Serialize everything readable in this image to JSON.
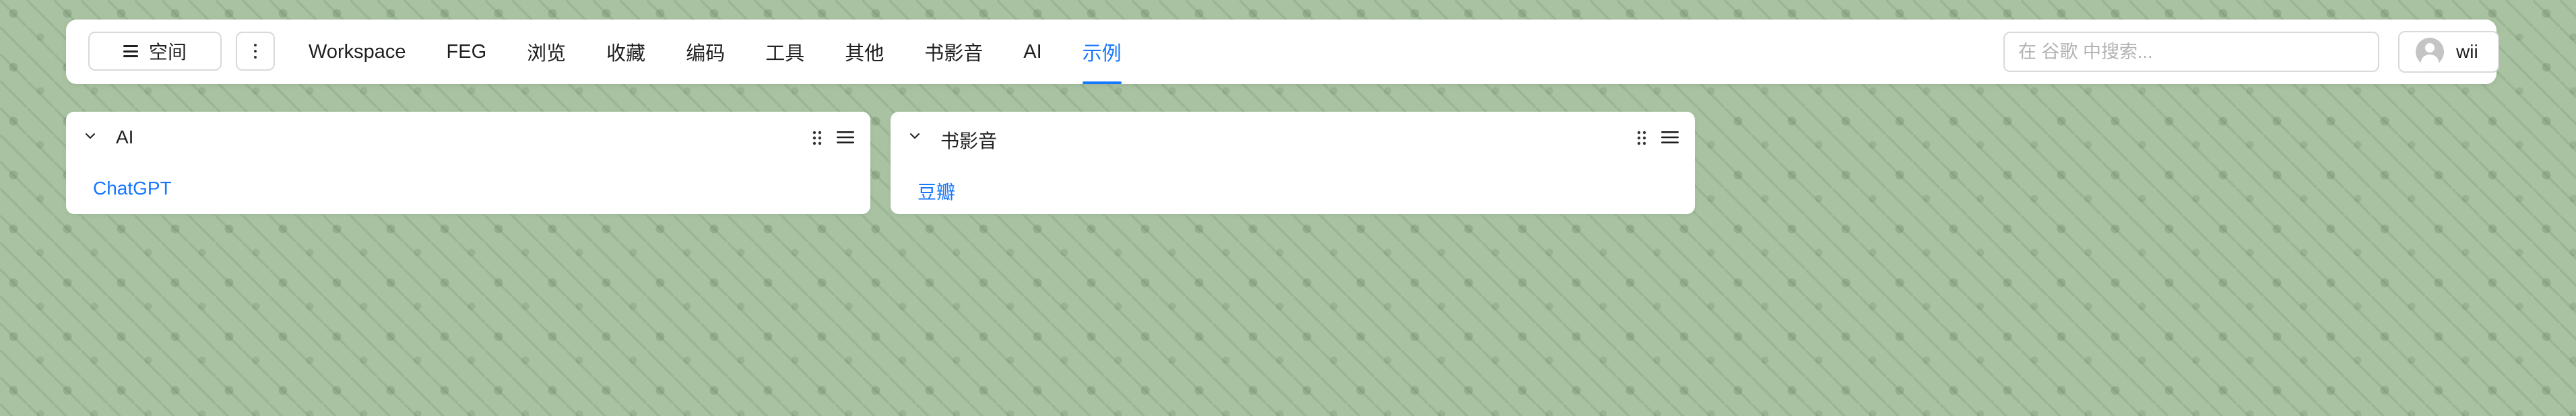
{
  "header": {
    "space_label": "空间",
    "tabs": [
      {
        "label": "Workspace"
      },
      {
        "label": "FEG"
      },
      {
        "label": "浏览"
      },
      {
        "label": "收藏"
      },
      {
        "label": "编码"
      },
      {
        "label": "工具"
      },
      {
        "label": "其他"
      },
      {
        "label": "书影音"
      },
      {
        "label": "AI"
      },
      {
        "label": "示例",
        "active": true
      }
    ],
    "search_placeholder": "在 谷歌 中搜索...",
    "user_name": "wii"
  },
  "cards": [
    {
      "title": "AI",
      "links": [
        "ChatGPT"
      ]
    },
    {
      "title": "书影音",
      "links": [
        "豆瓣"
      ]
    }
  ],
  "colors": {
    "accent": "#1677ff",
    "background": "#a9c3a2"
  }
}
